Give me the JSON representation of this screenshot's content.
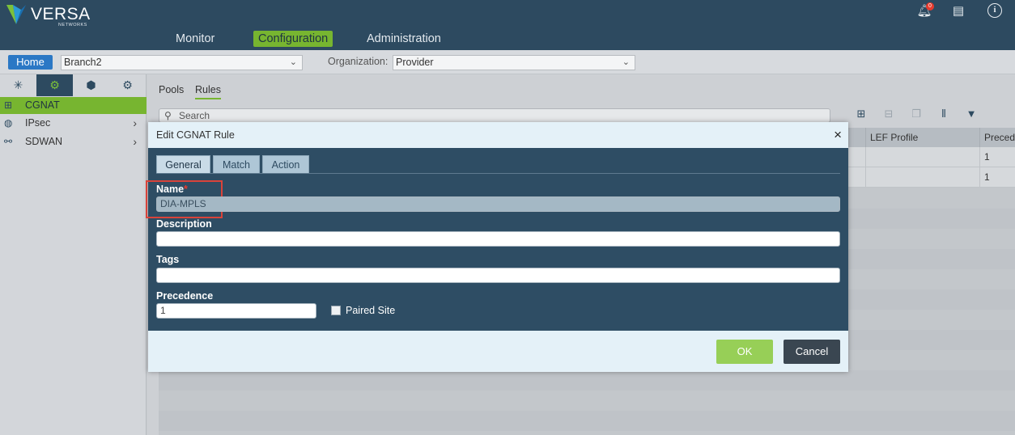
{
  "brand": {
    "name": "VERSA",
    "sub": "NETWORKS"
  },
  "nav": {
    "monitor": "Monitor",
    "configuration": "Configuration",
    "administration": "Administration"
  },
  "header_icons": {
    "notification_count": "0",
    "bell": "bell-icon",
    "docs": "document-icon",
    "info": "info-icon"
  },
  "context": {
    "home": "Home",
    "appliance": "Branch2",
    "org_label": "Organization:",
    "organization": "Provider"
  },
  "sidebar": {
    "tabs": [
      "network-icon",
      "gear-icon",
      "cube-icon",
      "settings-icon"
    ],
    "items": [
      {
        "label": "CGNAT",
        "icon": "cgnat-icon"
      },
      {
        "label": "IPsec",
        "icon": "globe-icon"
      },
      {
        "label": "SDWAN",
        "icon": "sdwan-icon"
      }
    ]
  },
  "content": {
    "tabs": [
      "Pools",
      "Rules"
    ],
    "search_placeholder": "Search",
    "columns": [
      "LEF Profile",
      "Precede"
    ],
    "rows": [
      {
        "precedence": "1"
      },
      {
        "precedence": "1"
      }
    ]
  },
  "modal": {
    "title": "Edit CGNAT Rule",
    "close": "×",
    "tabs": [
      "General",
      "Match",
      "Action"
    ],
    "name_label": "Name",
    "required_mark": "*",
    "name_value": "DIA-MPLS",
    "description_label": "Description",
    "description_value": "",
    "tags_label": "Tags",
    "tags_value": "",
    "precedence_label": "Precedence",
    "precedence_value": "1",
    "paired_site_label": "Paired Site",
    "paired_site_checked": false,
    "ok": "OK",
    "cancel": "Cancel"
  },
  "colors": {
    "header": "#2d4a60",
    "accent_green": "#77b530",
    "ok_green": "#97cf57",
    "cancel_dark": "#3a4651",
    "highlight_red": "#d9433a"
  }
}
